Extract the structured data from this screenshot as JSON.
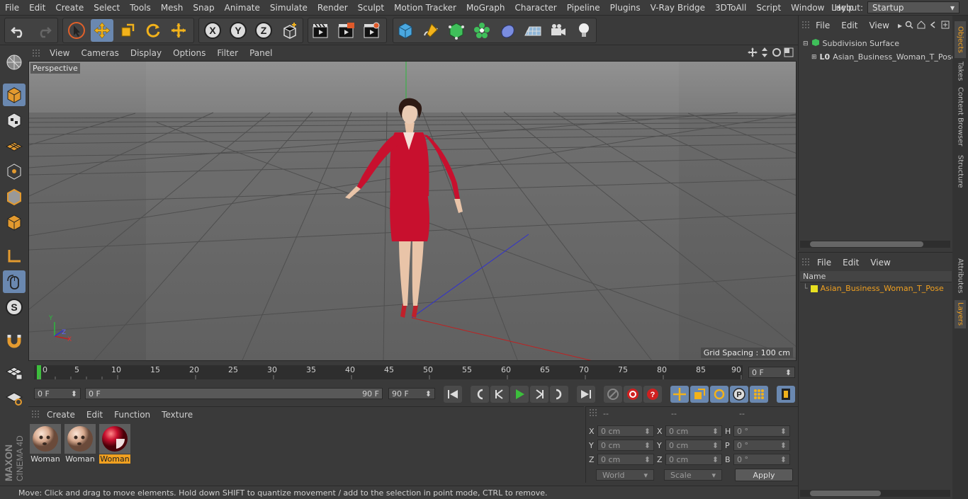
{
  "menubar": {
    "items": [
      "File",
      "Edit",
      "Create",
      "Select",
      "Tools",
      "Mesh",
      "Snap",
      "Animate",
      "Simulate",
      "Render",
      "Sculpt",
      "Motion Tracker",
      "MoGraph",
      "Character",
      "Pipeline",
      "Plugins",
      "V-Ray Bridge",
      "3DToAll",
      "Script",
      "Window",
      "Help"
    ],
    "layout_label": "Layout:",
    "layout_value": "Startup"
  },
  "viewport": {
    "menu": [
      "View",
      "Cameras",
      "Display",
      "Options",
      "Filter",
      "Panel"
    ],
    "camera_label": "Perspective",
    "grid_spacing": "Grid Spacing : 100 cm",
    "axis_labels": {
      "y": "Y",
      "z": "Z",
      "x": "X"
    }
  },
  "timeline": {
    "ticks": [
      "0",
      "5",
      "10",
      "15",
      "20",
      "25",
      "30",
      "35",
      "40",
      "45",
      "50",
      "55",
      "60",
      "65",
      "70",
      "75",
      "80",
      "85",
      "90"
    ],
    "current_frame": "0 F"
  },
  "playbar": {
    "start_field": "0 F",
    "range_start": "0 F",
    "range_end": "90 F",
    "end_field": "90 F"
  },
  "materials": {
    "menu": [
      "Create",
      "Edit",
      "Function",
      "Texture"
    ],
    "items": [
      {
        "label": "Woman",
        "selected": false
      },
      {
        "label": "Woman",
        "selected": false
      },
      {
        "label": "Woman",
        "selected": true
      }
    ]
  },
  "coords": {
    "header": [
      "--",
      "--",
      "--"
    ],
    "rows": [
      {
        "l1": "X",
        "v1": "0 cm",
        "l2": "X",
        "v2": "0 cm",
        "l3": "H",
        "v3": "0 °"
      },
      {
        "l1": "Y",
        "v1": "0 cm",
        "l2": "Y",
        "v2": "0 cm",
        "l3": "P",
        "v3": "0 °"
      },
      {
        "l1": "Z",
        "v1": "0 cm",
        "l2": "Z",
        "v2": "0 cm",
        "l3": "B",
        "v3": "0 °"
      }
    ],
    "space": "World",
    "mode": "Scale",
    "apply": "Apply"
  },
  "status": "Move: Click and drag to move elements. Hold down SHIFT to quantize movement / add to the selection in point mode, CTRL to remove.",
  "objects_panel": {
    "menu": [
      "File",
      "Edit",
      "View"
    ],
    "items": [
      "Subdivision Surface",
      "Asian_Business_Woman_T_Pose"
    ]
  },
  "layers_panel": {
    "menu": [
      "File",
      "Edit",
      "View"
    ],
    "column": "Name",
    "items": [
      "Asian_Business_Woman_T_Pose"
    ]
  },
  "side_tabs": [
    "Objects",
    "Takes",
    "Content Browser",
    "Structure",
    "Attributes",
    "Layers"
  ],
  "brand": {
    "line1": "MAXON",
    "line2": "CINEMA 4D"
  },
  "colors": {
    "accent": "#f0a020",
    "selected_tool": "#6a88b0",
    "layer": "#e8e020"
  }
}
